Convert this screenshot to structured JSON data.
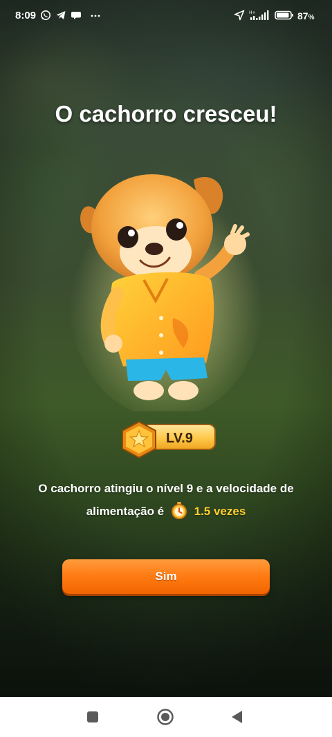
{
  "status_bar": {
    "time": "8:09",
    "battery_percent": "87",
    "battery_suffix": "%",
    "icons": [
      "whatsapp-icon",
      "telegram-icon",
      "chat-bubble-icon",
      "more-dots-icon",
      "location-arrow-icon",
      "signal-icon",
      "battery-icon"
    ]
  },
  "dialog": {
    "title": "O cachorro cresceu!",
    "level_label": "LV.9",
    "description_line1": "O cachorro atingiu o nível 9 e a velocidade de",
    "description_line2_prefix": "alimentação é",
    "speed_value": "1.5 vezes",
    "confirm_label": "Sim"
  },
  "nav_bar": {
    "buttons": [
      "recent-apps-icon",
      "home-icon",
      "back-icon"
    ]
  },
  "colors": {
    "accent_orange": "#ff7a12",
    "speed_yellow": "#ffcf2e",
    "badge_gold": "#ffc94a"
  }
}
